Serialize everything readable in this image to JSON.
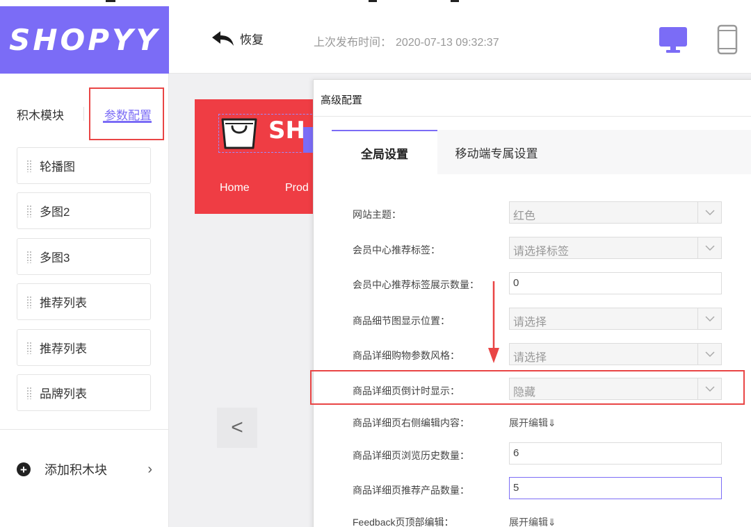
{
  "brand": {
    "logo": "SHOPYY",
    "accent": "#7b6cf6",
    "highlight": "#e94545"
  },
  "header": {
    "undo_label": "恢复",
    "publish_label": "上次发布时间：",
    "publish_time": "2020-07-13 09:32:37",
    "device_icons": [
      "desktop-icon",
      "mobile-icon"
    ]
  },
  "sidebar": {
    "tabs": [
      {
        "label": "积木模块"
      },
      {
        "label": "参数配置",
        "active": true
      }
    ],
    "blocks": [
      {
        "label": "轮播图"
      },
      {
        "label": "多图2"
      },
      {
        "label": "多图3"
      },
      {
        "label": "推荐列表"
      },
      {
        "label": "推荐列表"
      },
      {
        "label": "品牌列表"
      }
    ],
    "add_block_label": "添加积木块"
  },
  "preview": {
    "logo_text": "SH",
    "nav": [
      "Home",
      "Prod"
    ],
    "prev_glyph": "<",
    "header_color": "#ef3d44"
  },
  "dialog": {
    "title": "高级配置",
    "tabs": [
      {
        "label": "全局设置",
        "active": true
      },
      {
        "label": "移动端专属设置"
      }
    ],
    "fields": [
      {
        "label": "网站主题：",
        "type": "select",
        "value": "红色"
      },
      {
        "label": "会员中心推荐标签：",
        "type": "select",
        "value": "请选择标签"
      },
      {
        "label": "会员中心推荐标签展示数量：",
        "type": "input",
        "value": "0"
      },
      {
        "label": "商品细节图显示位置：",
        "type": "select",
        "value": "请选择"
      },
      {
        "label": "商品详细购物参数风格：",
        "type": "select",
        "value": "请选择"
      },
      {
        "label": "商品详细页倒计时显示：",
        "type": "select",
        "value": "隐藏",
        "highlighted": true
      },
      {
        "label": "商品详细页右侧编辑内容：",
        "type": "link",
        "value": "展开编辑⇓"
      },
      {
        "label": "商品详细页浏览历史数量：",
        "type": "input",
        "value": "6"
      },
      {
        "label": "商品详细页推荐产品数量：",
        "type": "input",
        "value": "5",
        "focused": true
      },
      {
        "label": "Feedback页顶部编辑：",
        "type": "link",
        "value": "展开编辑⇓"
      }
    ]
  }
}
